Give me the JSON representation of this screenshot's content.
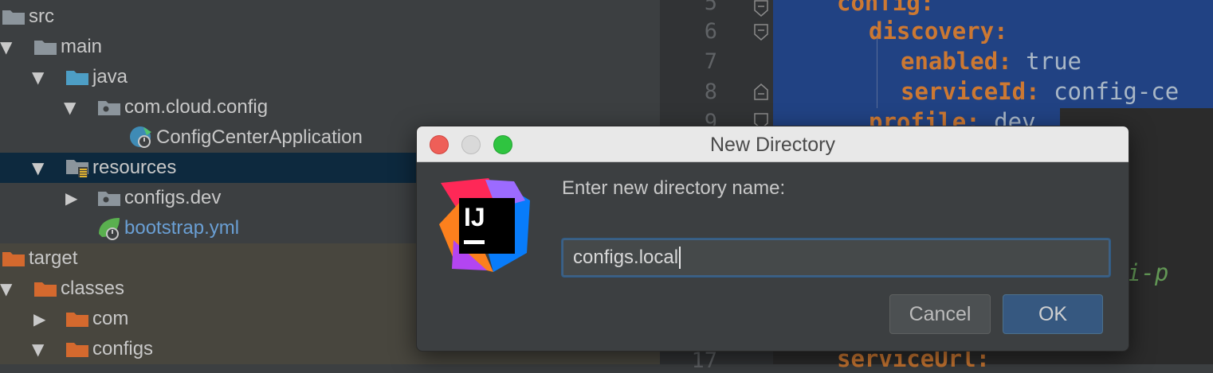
{
  "project_tree": {
    "items": [
      {
        "label": "src",
        "icon": "folder-icon",
        "expanded": null
      },
      {
        "label": "main",
        "icon": "folder-icon",
        "expanded": true
      },
      {
        "label": "java",
        "icon": "source-folder-icon",
        "expanded": true
      },
      {
        "label": "com.cloud.config",
        "icon": "package-icon",
        "expanded": true
      },
      {
        "label": "ConfigCenterApplication",
        "icon": "spring-boot-class-icon",
        "expanded": null
      },
      {
        "label": "resources",
        "icon": "resources-folder-icon",
        "expanded": true,
        "selected": true
      },
      {
        "label": "configs.dev",
        "icon": "package-icon",
        "expanded": false
      },
      {
        "label": "bootstrap.yml",
        "icon": "spring-yml-icon",
        "expanded": null
      },
      {
        "label": "target",
        "icon": "excluded-folder-icon",
        "expanded": null
      },
      {
        "label": "classes",
        "icon": "excluded-folder-icon",
        "expanded": true
      },
      {
        "label": "com",
        "icon": "excluded-folder-icon",
        "expanded": false
      },
      {
        "label": "configs",
        "icon": "excluded-folder-icon",
        "expanded": true
      }
    ]
  },
  "editor": {
    "line_numbers": [
      "5",
      "6",
      "7",
      "8",
      "9",
      "17"
    ],
    "lines": [
      {
        "key": "config:",
        "value": ""
      },
      {
        "key": "discovery:",
        "value": ""
      },
      {
        "key": "enabled:",
        "value": " true"
      },
      {
        "key": "serviceId:",
        "value": " config-ce"
      },
      {
        "key": "profile:",
        "value": " dev"
      },
      {
        "key": "serviceUrl:",
        "value": ""
      }
    ],
    "partial_comment": "i-p"
  },
  "dialog": {
    "title": "New Directory",
    "prompt": "Enter new directory name:",
    "input_value": "configs.local",
    "cancel_label": "Cancel",
    "ok_label": "OK",
    "logo_text": "IJ",
    "colors": {
      "close": "#ee5f58",
      "minimize": "#d9d9d9",
      "zoom": "#2fc440",
      "ok_button": "#365880",
      "accent_border": "#3d6185"
    }
  }
}
